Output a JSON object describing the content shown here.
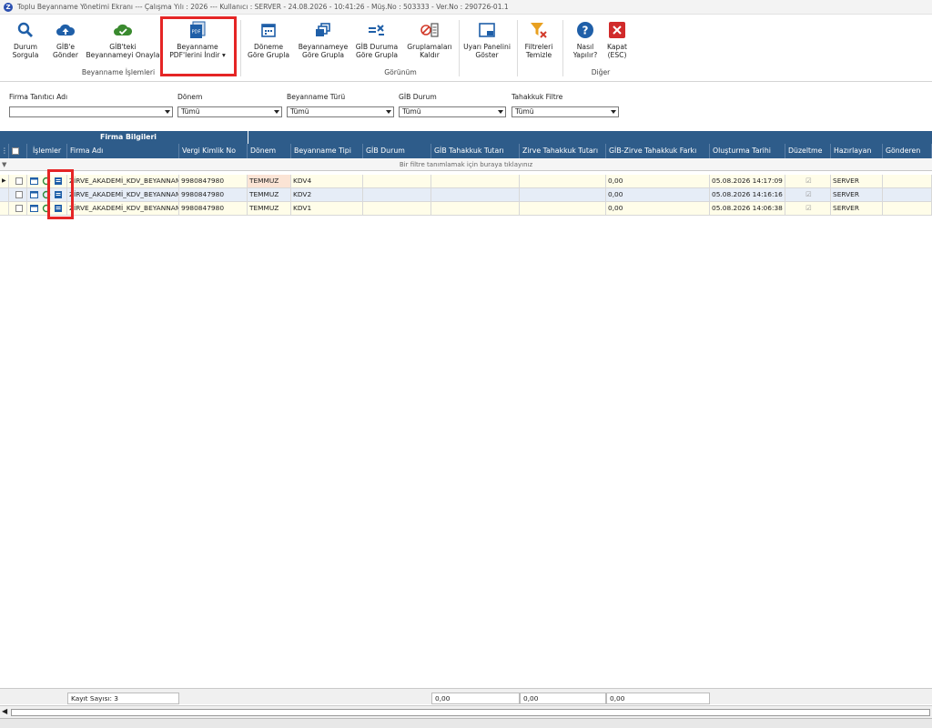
{
  "titlebar": {
    "app_letter": "Z",
    "text": "Toplu Beyanname Yönetimi Ekranı  ---  Çalışma Yılı : 2026  ---  Kullanıcı : SERVER - 24.08.2026 - 10:41:26 - Müş.No : 503333 - Ver.No : 290726-01.1"
  },
  "ribbon": {
    "buttons": [
      {
        "line1": "Durum",
        "line2": "Sorgula",
        "icon": "magnifier-icon"
      },
      {
        "line1": "GİB'e",
        "line2": "Gönder",
        "icon": "cloud-upload-icon"
      },
      {
        "line1": "GİB'teki",
        "line2": "Beyannameyi Onayla",
        "icon": "cloud-check-icon"
      },
      {
        "line1": "Beyanname",
        "line2": "PDF'lerini İndir",
        "icon": "pdf-icon"
      },
      {
        "line1": "Döneme",
        "line2": "Göre Grupla",
        "icon": "calendar-icon"
      },
      {
        "line1": "Beyannameye",
        "line2": "Göre Grupla",
        "icon": "stack-icon"
      },
      {
        "line1": "GİB Duruma",
        "line2": "Göre Grupla",
        "icon": "equals-x-icon"
      },
      {
        "line1": "Gruplamaları",
        "line2": "Kaldır",
        "icon": "remove-group-icon"
      },
      {
        "line1": "Uyarı Panelini",
        "line2": "Göster",
        "icon": "panel-icon"
      },
      {
        "line1": "Filtreleri",
        "line2": "Temizle",
        "icon": "filter-clear-icon"
      },
      {
        "line1": "Nasıl",
        "line2": "Yapılır?",
        "icon": "help-icon"
      },
      {
        "line1": "Kapat",
        "line2": "(ESC)",
        "icon": "close-icon"
      }
    ],
    "groups": {
      "g1": "Beyanname İşlemleri",
      "g2": "Görünüm",
      "g3": "Diğer"
    }
  },
  "filters": {
    "firma_label": "Firma Tanıtıcı Adı",
    "firma_value": "",
    "donem_label": "Dönem",
    "donem_value": "Tümü",
    "tur_label": "Beyanname Türü",
    "tur_value": "Tümü",
    "gib_label": "GİB Durum",
    "gib_value": "Tümü",
    "tahakkuk_label": "Tahakkuk Filtre",
    "tahakkuk_value": "Tümü"
  },
  "grid": {
    "band": "Firma Bilgileri",
    "columns": {
      "islemler": "İşlemler",
      "firma": "Firma Adı",
      "vergi": "Vergi Kimlik No",
      "donem": "Dönem",
      "tip": "Beyanname Tipi",
      "gib": "GİB Durum",
      "gibtah": "GİB Tahakkuk Tutarı",
      "zirvetah": "Zirve Tahakkuk Tutarı",
      "fark": "GİB-Zirve Tahakkuk Farkı",
      "tarih": "Oluşturma Tarihi",
      "duzeltme": "Düzeltme",
      "hazirlayan": "Hazırlayan",
      "gonderen": "Gönderen"
    },
    "filter_hint": "Bir filtre tanımlamak için buraya tıklayınız",
    "rows": [
      {
        "firma": "ZİRVE_AKADEMİ_KDV_BEYANNAME",
        "vergi": "9980847980",
        "donem": "TEMMUZ",
        "tip": "KDV4",
        "fark": "0,00",
        "tarih": "05.08.2026 14:17:09",
        "hazirlayan": "SERVER"
      },
      {
        "firma": "ZİRVE_AKADEMİ_KDV_BEYANNAME",
        "vergi": "9980847980",
        "donem": "TEMMUZ",
        "tip": "KDV2",
        "fark": "0,00",
        "tarih": "05.08.2026 14:16:16",
        "hazirlayan": "SERVER"
      },
      {
        "firma": "ZİRVE_AKADEMİ_KDV_BEYANNAME",
        "vergi": "9980847980",
        "donem": "TEMMUZ",
        "tip": "KDV1",
        "fark": "0,00",
        "tarih": "05.08.2026 14:06:38",
        "hazirlayan": "SERVER"
      }
    ]
  },
  "summary": {
    "count": "Kayıt Sayısı: 3",
    "gib_total": "0,00",
    "zirve_total": "0,00",
    "fark_total": "0,00"
  },
  "colors": {
    "header": "#2e5c8a",
    "highlight": "#e52525",
    "selected_cell": "#fbe4d5"
  }
}
